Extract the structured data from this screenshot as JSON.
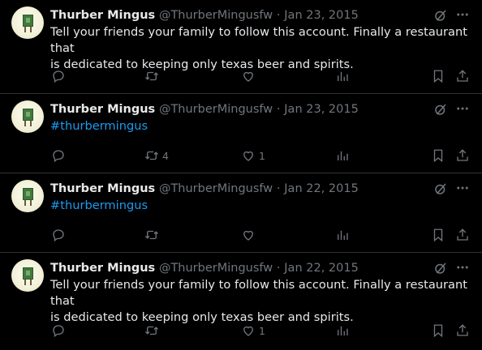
{
  "tweets": [
    {
      "name": "Thurber Mingus",
      "handle": "@ThurberMingusfw",
      "sep": "·",
      "date": "Jan 23, 2015",
      "text_line1": "Tell your friends your family to follow this account. Finally a restaurant that",
      "text_line2": "is dedicated to keeping only texas beer and spirits.",
      "hashtag": "",
      "retweets": "",
      "likes": ""
    },
    {
      "name": "Thurber Mingus",
      "handle": "@ThurberMingusfw",
      "sep": "·",
      "date": "Jan 23, 2015",
      "text_line1": "",
      "text_line2": "",
      "hashtag": "#thurbermingus",
      "retweets": "4",
      "likes": "1"
    },
    {
      "name": "Thurber Mingus",
      "handle": "@ThurberMingusfw",
      "sep": "·",
      "date": "Jan 22, 2015",
      "text_line1": "",
      "text_line2": "",
      "hashtag": "#thurbermingus",
      "retweets": "",
      "likes": ""
    },
    {
      "name": "Thurber Mingus",
      "handle": "@ThurberMingusfw",
      "sep": "·",
      "date": "Jan 22, 2015",
      "text_line1": "Tell your friends your family to follow this account. Finally a restaurant that",
      "text_line2": "is dedicated to keeping only texas beer and spirits.",
      "hashtag": "",
      "retweets": "",
      "likes": "1"
    }
  ],
  "icons": {
    "reply": "reply-icon",
    "retweet": "retweet-icon",
    "like": "heart-icon",
    "views": "views-icon",
    "bookmark": "bookmark-icon",
    "share": "share-icon",
    "grok": "grok-icon",
    "more": "more-icon"
  },
  "colors": {
    "background": "#000000",
    "text": "#e7e9ea",
    "secondary": "#71767b",
    "link": "#1d9bf0",
    "divider": "#2f3336"
  }
}
